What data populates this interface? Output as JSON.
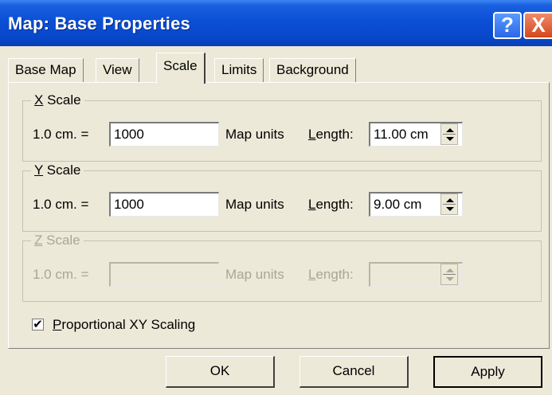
{
  "window": {
    "title": "Map: Base Properties",
    "help_label": "?",
    "close_label": "X"
  },
  "tabs": [
    {
      "label": "Base Map"
    },
    {
      "label": "View"
    },
    {
      "label": "Scale",
      "active": true
    },
    {
      "label": "Limits"
    },
    {
      "label": "Background"
    }
  ],
  "x_scale": {
    "legend_key": "X",
    "legend_rest": " Scale",
    "cm_label": "1.0 cm. =",
    "value": "1000",
    "units_label": "Map units",
    "length_key": "L",
    "length_rest": "ength:",
    "length_value": "11.00 cm"
  },
  "y_scale": {
    "legend_key": "Y",
    "legend_rest": " Scale",
    "cm_label": "1.0 cm. =",
    "value": "1000",
    "units_label": "Map units",
    "length_key": "L",
    "length_rest": "ength:",
    "length_value": "9.00 cm"
  },
  "z_scale": {
    "legend_key": "Z",
    "legend_rest": " Scale",
    "cm_label": "1.0 cm. =",
    "value": "",
    "units_label": "Map units",
    "length_key": "L",
    "length_rest": "ength:",
    "length_value": "",
    "enabled": false
  },
  "proportional": {
    "checked": true,
    "check_mark": "✔",
    "label_key": "P",
    "label_rest": "roportional XY Scaling"
  },
  "buttons": {
    "ok": "OK",
    "cancel": "Cancel",
    "apply": "Apply"
  }
}
